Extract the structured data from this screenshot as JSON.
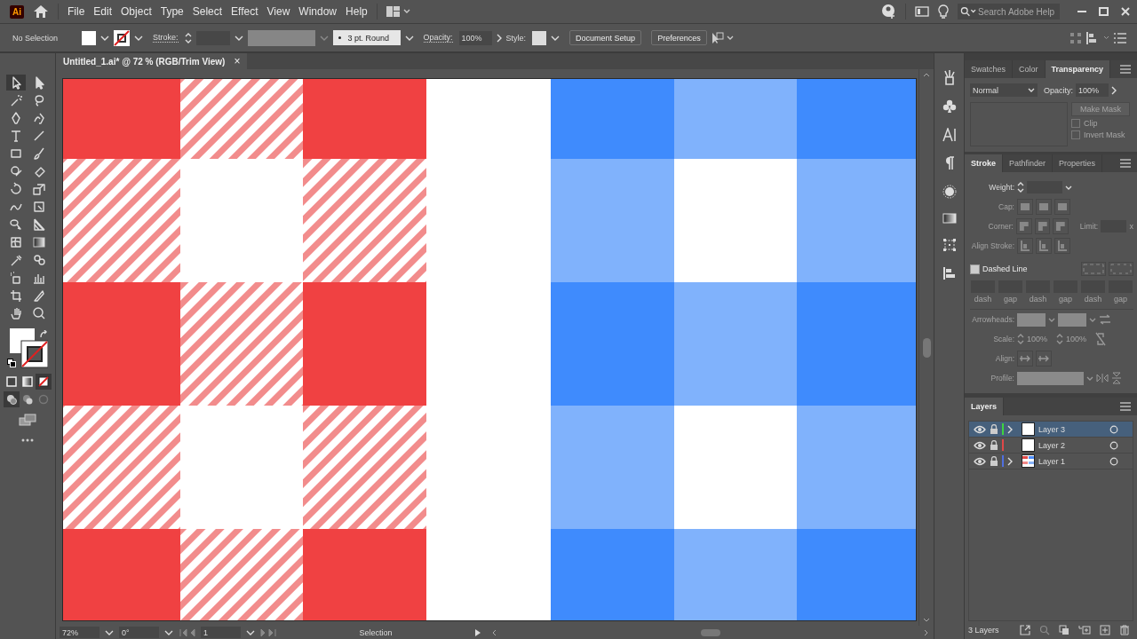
{
  "app": {
    "logo": "Ai"
  },
  "menu": [
    "File",
    "Edit",
    "Object",
    "Type",
    "Select",
    "Effect",
    "View",
    "Window",
    "Help"
  ],
  "search": {
    "placeholder": "Search Adobe Help"
  },
  "control_bar": {
    "selection": "No Selection",
    "stroke_label": "Stroke:",
    "brush": "3 pt. Round",
    "opacity_label": "Opacity:",
    "opacity": "100%",
    "style_label": "Style:",
    "buttons": [
      "Document Setup",
      "Preferences"
    ]
  },
  "document_tab": {
    "title": "Untitled_1.ai* @ 72 % (RGB/Trim View)",
    "close": "×"
  },
  "transparency_panel": {
    "tabs": [
      {
        "label": "Swatches",
        "selected": false
      },
      {
        "label": "Color",
        "selected": false
      },
      {
        "label": "Transparency",
        "selected": true
      }
    ],
    "blend_mode": "Normal",
    "opacity_label": "Opacity:",
    "opacity": "100%",
    "make_mask": "Make Mask",
    "options": [
      {
        "label": "Clip",
        "checked": false
      },
      {
        "label": "Invert Mask",
        "checked": false
      }
    ]
  },
  "stroke_panel": {
    "tabs": [
      {
        "label": "Stroke",
        "selected": true
      },
      {
        "label": "Pathfinder",
        "selected": false
      },
      {
        "label": "Properties",
        "selected": false
      }
    ],
    "disabled": true,
    "weight_label": "Weight:",
    "cap_label": "Cap:",
    "corner_label": "Corner:",
    "limit_label": "Limit:",
    "limit_unit": "x",
    "align_stroke_label": "Align Stroke:",
    "dashed_line": {
      "label": "Dashed Line",
      "checked": false
    },
    "dash_fields": [
      "dash",
      "gap",
      "dash",
      "gap",
      "dash",
      "gap"
    ],
    "arrowheads_label": "Arrowheads:",
    "scale_label": "Scale:",
    "scales": [
      "100%",
      "100%"
    ],
    "align_label": "Align:",
    "profile_label": "Profile:"
  },
  "layers_panel": {
    "tab": "Layers",
    "layers": [
      {
        "name": "Layer 3",
        "selected": true,
        "color": "#3ed43e",
        "expandable": true,
        "kind": "blank"
      },
      {
        "name": "Layer 2",
        "selected": false,
        "color": "#e04848",
        "expandable": false,
        "kind": "blank"
      },
      {
        "name": "Layer 1",
        "selected": false,
        "color": "#4f6fe0",
        "expandable": true,
        "kind": "pattern"
      }
    ],
    "count": "3 Layers"
  },
  "status_bar": {
    "zoom": "72%",
    "rotation": "0°",
    "artboard": "1",
    "tool": "Selection"
  }
}
